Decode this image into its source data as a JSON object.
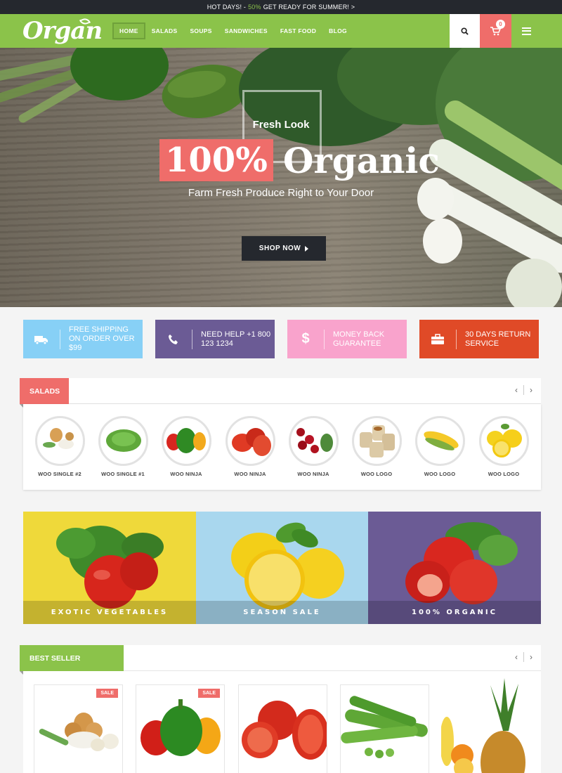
{
  "topbar": {
    "prefix": "HOT DAYS! -",
    "highlight": "50%",
    "suffix": "GET READY FOR SUMMER! >"
  },
  "header": {
    "logo": "Organ",
    "nav": [
      "HOME",
      "SALADS",
      "SOUPS",
      "SANDWICHES",
      "FAST FOOD",
      "BLOG"
    ],
    "cart_count": "0",
    "icons": {
      "search": "search-icon",
      "cart": "cart-icon",
      "menu": "menu-icon"
    }
  },
  "hero": {
    "subtitle": "Fresh Look",
    "percent": "100%",
    "word": "Organic",
    "tagline": "Farm Fresh Produce Right to Your Door",
    "button": "SHOP NOW"
  },
  "features": [
    {
      "text": "FREE SHIPPING ON ORDER OVER $99",
      "icon": "truck-icon",
      "color": "#87d0f6"
    },
    {
      "text": "NEED HELP +1 800 123 1234",
      "icon": "phone-icon",
      "color": "#6b5b95"
    },
    {
      "text": "MONEY BACK GUARANTEE",
      "icon": "dollar-icon",
      "color": "#f9a3cc"
    },
    {
      "text": "30 DAYS RETURN SERVICE",
      "icon": "briefcase-icon",
      "color": "#e04a27"
    }
  ],
  "salads": {
    "title": "SALADS",
    "products": [
      "WOO SINGLE #2",
      "WOO SINGLE #1",
      "WOO NINJA",
      "WOO NINJA",
      "WOO NINJA",
      "WOO LOGO",
      "WOO LOGO",
      "WOO LOGO"
    ]
  },
  "promos": [
    {
      "label": "EXOTIC VEGETABLES",
      "color": "#efd93a"
    },
    {
      "label": "SEASON SALE",
      "color": "#a9d7ee"
    },
    {
      "label": "100% ORGANIC",
      "color": "#6b5b95"
    }
  ],
  "best_seller": {
    "title": "BEST SELLER",
    "sale_label": "SALE"
  },
  "colors": {
    "green": "#8bc34a",
    "coral": "#ef6d6a",
    "dark": "#25282e"
  }
}
